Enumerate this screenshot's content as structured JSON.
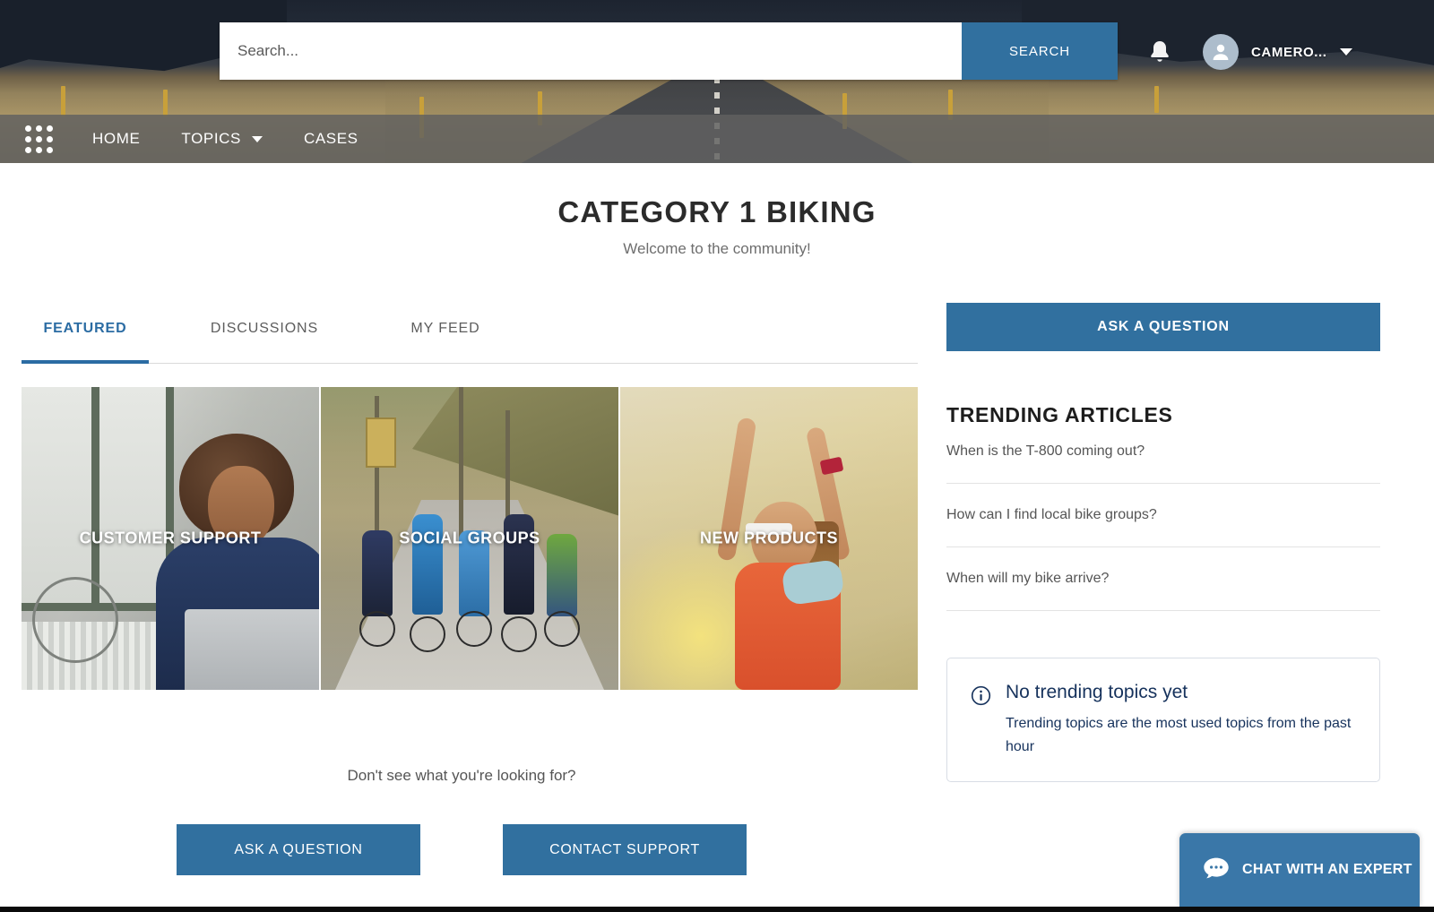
{
  "header": {
    "search": {
      "value": "",
      "placeholder": "Search...",
      "button_label": "SEARCH"
    },
    "notifications_icon": "bell-icon",
    "user": {
      "name": "CAMERO...",
      "avatar_icon": "user-avatar-icon"
    }
  },
  "nav": {
    "app_launcher_icon": "app-launcher-grid-icon",
    "items": [
      {
        "label": "HOME",
        "has_caret": false
      },
      {
        "label": "TOPICS",
        "has_caret": true
      },
      {
        "label": "CASES",
        "has_caret": false
      }
    ]
  },
  "page": {
    "title": "CATEGORY 1 BIKING",
    "subtitle": "Welcome to the community!"
  },
  "tabs": [
    {
      "label": "FEATURED",
      "active": true
    },
    {
      "label": "DISCUSSIONS",
      "active": false
    },
    {
      "label": "MY FEED",
      "active": false
    }
  ],
  "featured_cards": [
    {
      "label": "CUSTOMER SUPPORT"
    },
    {
      "label": "SOCIAL GROUPS"
    },
    {
      "label": "NEW PRODUCTS"
    }
  ],
  "cta": {
    "note": "Don't see what you're looking for?",
    "ask_label": "ASK A QUESTION",
    "contact_label": "CONTACT SUPPORT"
  },
  "sidebar": {
    "ask_label": "ASK A QUESTION",
    "trending_heading": "TRENDING ARTICLES",
    "articles": [
      "When is the T-800 coming out?",
      "How can I find local bike groups?",
      "When will my bike arrive?"
    ],
    "info": {
      "icon": "info-circle-icon",
      "title": "No trending topics yet",
      "body": "Trending topics are the most used topics from the past hour"
    }
  },
  "chat": {
    "icon": "chat-bubble-icon",
    "label": "CHAT WITH AN EXPERT"
  },
  "colors": {
    "accent_blue": "#31709f",
    "nav_gray": "#606060",
    "info_navy": "#16325c",
    "tab_active": "#2b6ca3"
  }
}
